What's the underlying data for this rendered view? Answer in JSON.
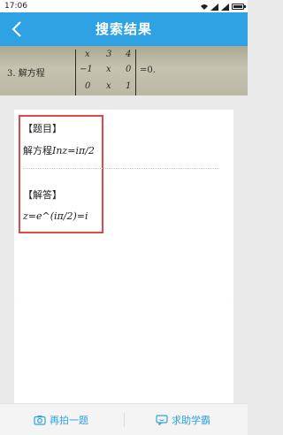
{
  "status_bar": {
    "time": "17:06"
  },
  "header": {
    "title": "搜索结果"
  },
  "photo": {
    "problem_number": "3. 解方程",
    "matrix_rows": [
      [
        "x",
        "3",
        "4"
      ],
      [
        "−1",
        "x",
        "0"
      ],
      [
        "0",
        "x",
        "1"
      ]
    ],
    "equals": "=0."
  },
  "result": {
    "question_label": "【题目】",
    "question_prefix": "解方程",
    "question_math": "Inz=iπ/2",
    "answer_label": "【解答】",
    "answer_math": "z=e^(iπ/2)=i"
  },
  "footer": {
    "retake_label": "再拍一题",
    "help_label": "求助学霸"
  },
  "colors": {
    "accent": "#2fa2e3",
    "highlight": "#e04848"
  }
}
